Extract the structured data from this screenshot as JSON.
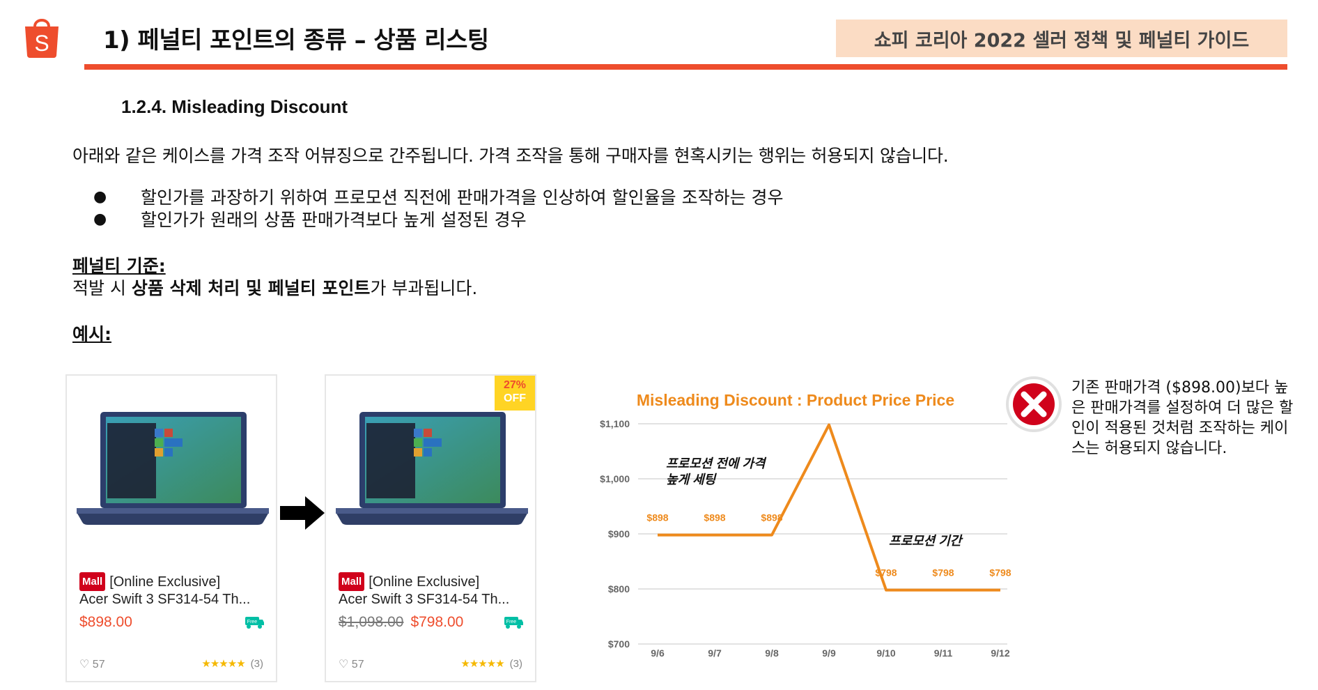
{
  "header": {
    "title": "1) 페널티 포인트의 종류 – 상품 리스팅",
    "badge": "쇼피 코리아 2022 셀러 정책 및 페널티 가이드",
    "logo_letter": "S",
    "brand_color": "#ee4d2d"
  },
  "section": {
    "heading": "1.2.4. Misleading Discount",
    "intro": "아래와 같은 케이스를 가격 조작 어뷰징으로 간주됩니다. 가격 조작을 통해 구매자를 현혹시키는 행위는 허용되지 않습니다.",
    "bullets": [
      "할인가를 과장하기 위하여 프로모션 직전에 판매가격을 인상하여 할인율을 조작하는 경우",
      "할인가가 원래의 상품 판매가격보다 높게 설정된 경우"
    ],
    "criteria_label": "페널티 기준:",
    "criteria_pre": "적발 시 ",
    "criteria_bold": "상품 삭제 처리 및 페널티 포인트",
    "criteria_post": "가 부과됩니다.",
    "example_label": "예시:"
  },
  "cards": [
    {
      "mall": "Mall",
      "name_line1": "[Online Exclusive]",
      "name_line2": "Acer Swift 3 SF314-54 Th...",
      "old_price": "",
      "price": "$898.00",
      "likes": "57",
      "rating_count": "(3)",
      "stars": "★★★★★",
      "shipping_label": "Free"
    },
    {
      "mall": "Mall",
      "name_line1": "[Online Exclusive]",
      "name_line2": "Acer Swift 3 SF314-54 Th...",
      "old_price": "$1,098.00",
      "price": "$798.00",
      "likes": "57",
      "rating_count": "(3)",
      "stars": "★★★★★",
      "shipping_label": "Free",
      "discount_pct": "27%",
      "discount_off": "OFF"
    }
  ],
  "chart_data": {
    "type": "line",
    "title": "Misleading Discount : Product Price Price",
    "categories": [
      "9/6",
      "9/7",
      "9/8",
      "9/9",
      "9/10",
      "9/11",
      "9/12"
    ],
    "series": [
      {
        "values": [
          898,
          898,
          898,
          1098,
          798,
          798,
          798
        ],
        "color": "#ee8a1c"
      }
    ],
    "data_labels": [
      "$898",
      "$898",
      "$898",
      "",
      "$798",
      "$798",
      "$798"
    ],
    "y_ticks": [
      "$700",
      "$800",
      "$900",
      "$1,000",
      "$1,100"
    ],
    "ylim": [
      700,
      1100
    ],
    "annotations": {
      "pre_promo_line1": "프로모션 전에 가격",
      "pre_promo_line2": "높게 세팅",
      "promo_period": "프로모션 기간"
    },
    "grid": true
  },
  "note": {
    "text": "기존 판매가격 ($898.00)보다 높은 판매가격를 설정하여 더 많은 할인이 적용된 것처럼 조작하는 케이스는 허용되지 않습니다.",
    "icon": "x-circle-icon"
  }
}
